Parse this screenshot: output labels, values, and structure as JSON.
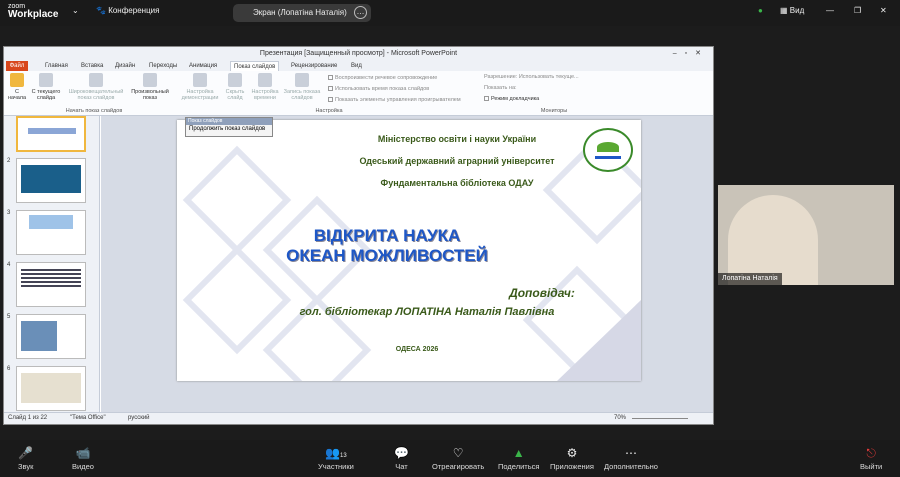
{
  "zoom": {
    "brand_line1": "zoom",
    "brand_line2": "Workplace",
    "conference": "Конференция",
    "screen_label": "Экран (Лопатіна Наталія)",
    "view": "Вид",
    "participant_count": "13",
    "toolbar": {
      "audio": "Звук",
      "video": "Видео",
      "participants": "Участники",
      "chat": "Чат",
      "react": "Отреагировать",
      "share": "Поделиться",
      "apps": "Приложения",
      "more": "Дополнительно",
      "leave": "Выйти"
    },
    "participant_name": "Лопатіна Наталія"
  },
  "ppt": {
    "title": "Презентация [Защищенный просмотр] - Microsoft PowerPoint",
    "tabs": [
      "Файл",
      "Главная",
      "Вставка",
      "Дизайн",
      "Переходы",
      "Анимация",
      "Показ слайдов",
      "Рецензирование",
      "Вид"
    ],
    "ribbon": {
      "from_start": "С начала",
      "from_current": "С текущего слайда",
      "broadcast": "Широковещательный показ слайдов",
      "custom": "Произвольный показ",
      "setup": "Настройка демонстрации",
      "hide": "Скрыть слайд",
      "timing": "Настройка времени",
      "record": "Запись показа слайдов",
      "narration": "Воспроизвести речевое сопровождение",
      "use_timings": "Использовать время показа слайдов",
      "media": "Показать элементы управления проигрывателем",
      "resolution_label": "Разрешение:",
      "resolution_value": "Использовать текуще...",
      "show_on": "Показать на:",
      "presenter": "Режим докладчика",
      "group1": "Начать показ слайдов",
      "group2": "Настройка",
      "group3": "Мониторы"
    },
    "popup": {
      "title": "Показ слайдов",
      "button": "Продолжить показ слайдов"
    },
    "slide": {
      "line1": "Міністерство освіти і науки України",
      "line2": "Одеський державний аграрний університет",
      "line3": "Фундаментальна бібліотека ОДАУ",
      "title1": "ВІДКРИТА НАУКА",
      "title2": "ОКЕАН МОЖЛИВОСТЕЙ",
      "speaker_label": "Доповідач:",
      "speaker": "гол. бібліотекар ЛОПАТІНА Наталія Павлівна",
      "city": "ОДЕСА 2026"
    },
    "thumb_nums": [
      "2",
      "3",
      "4",
      "5",
      "6"
    ],
    "status": {
      "slide": "Слайд 1 из 22",
      "theme": "\"Тема Office\"",
      "lang": "русский",
      "zoom": "70%"
    }
  },
  "colors": {
    "slide_title": "#1e57c6",
    "slide_text": "#3a5a1a",
    "accent": "#d8461b"
  }
}
